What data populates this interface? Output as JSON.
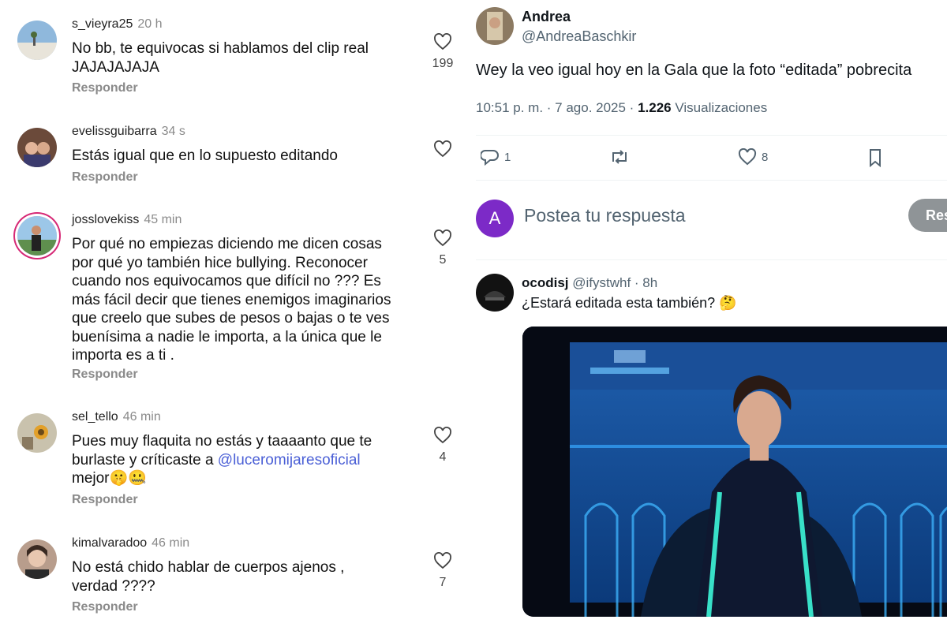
{
  "comments": [
    {
      "username": "s_vieyra25",
      "time": "20 h",
      "lines": [
        "No bb, te equivocas si hablamos del clip real",
        "JAJAJAJAJA"
      ],
      "reply": "Responder",
      "likes": "199"
    },
    {
      "username": "evelissguibarra",
      "time": "34 s",
      "lines": [
        "Estás igual que en lo supuesto editando"
      ],
      "reply": "Responder",
      "likes": ""
    },
    {
      "username": "josslovekiss",
      "time": "45 min",
      "lines": [
        "Por qué no empiezas diciendo me dicen cosas",
        "por qué yo también hice bullying. Reconocer",
        "cuando nos equivocamos que difícil no ??? Es",
        "más fácil decir que tienes enemigos imaginarios",
        "que creelo que subes de pesos o bajas o te ves",
        "buenísima a nadie le importa, a la única que le",
        "importa es a ti ."
      ],
      "reply": "Responder",
      "likes": "5"
    },
    {
      "username": "sel_tello",
      "time": "46 min",
      "lines": [
        "Pues muy flaquita no estás y taaaanto que te",
        "burlaste y críticaste a ",
        "mejor🤫🤐"
      ],
      "mention": "@luceromijaresoficial",
      "reply": "Responder",
      "likes": "4"
    },
    {
      "username": "kimalvaradoo",
      "time": "46 min",
      "lines": [
        "No está chido hablar de cuerpos ajenos ,",
        "verdad ????"
      ],
      "reply": "Responder",
      "likes": "7"
    }
  ],
  "tweet": {
    "name": "Andrea",
    "handle": "@AndreaBaschkir",
    "text": "Wey la veo igual hoy en la Gala que la foto “editada” pobrecita",
    "time": "10:51 p. m. · 7 ago. 2025 · ",
    "views_count": "1.226",
    "views_label": " Visualizaciones",
    "replies": "1",
    "likes": "8"
  },
  "compose": {
    "avatar_letter": "A",
    "placeholder": "Postea tu respuesta",
    "button": "Res"
  },
  "reply_tweet": {
    "name": "ocodisj",
    "handle": "@ifystwhf · 8h",
    "text": "¿Estará editada esta también? 🤔"
  },
  "icons": {
    "like": "heart-icon",
    "reply": "comment-icon",
    "retweet": "retweet-icon",
    "bookmark": "bookmark-icon"
  }
}
